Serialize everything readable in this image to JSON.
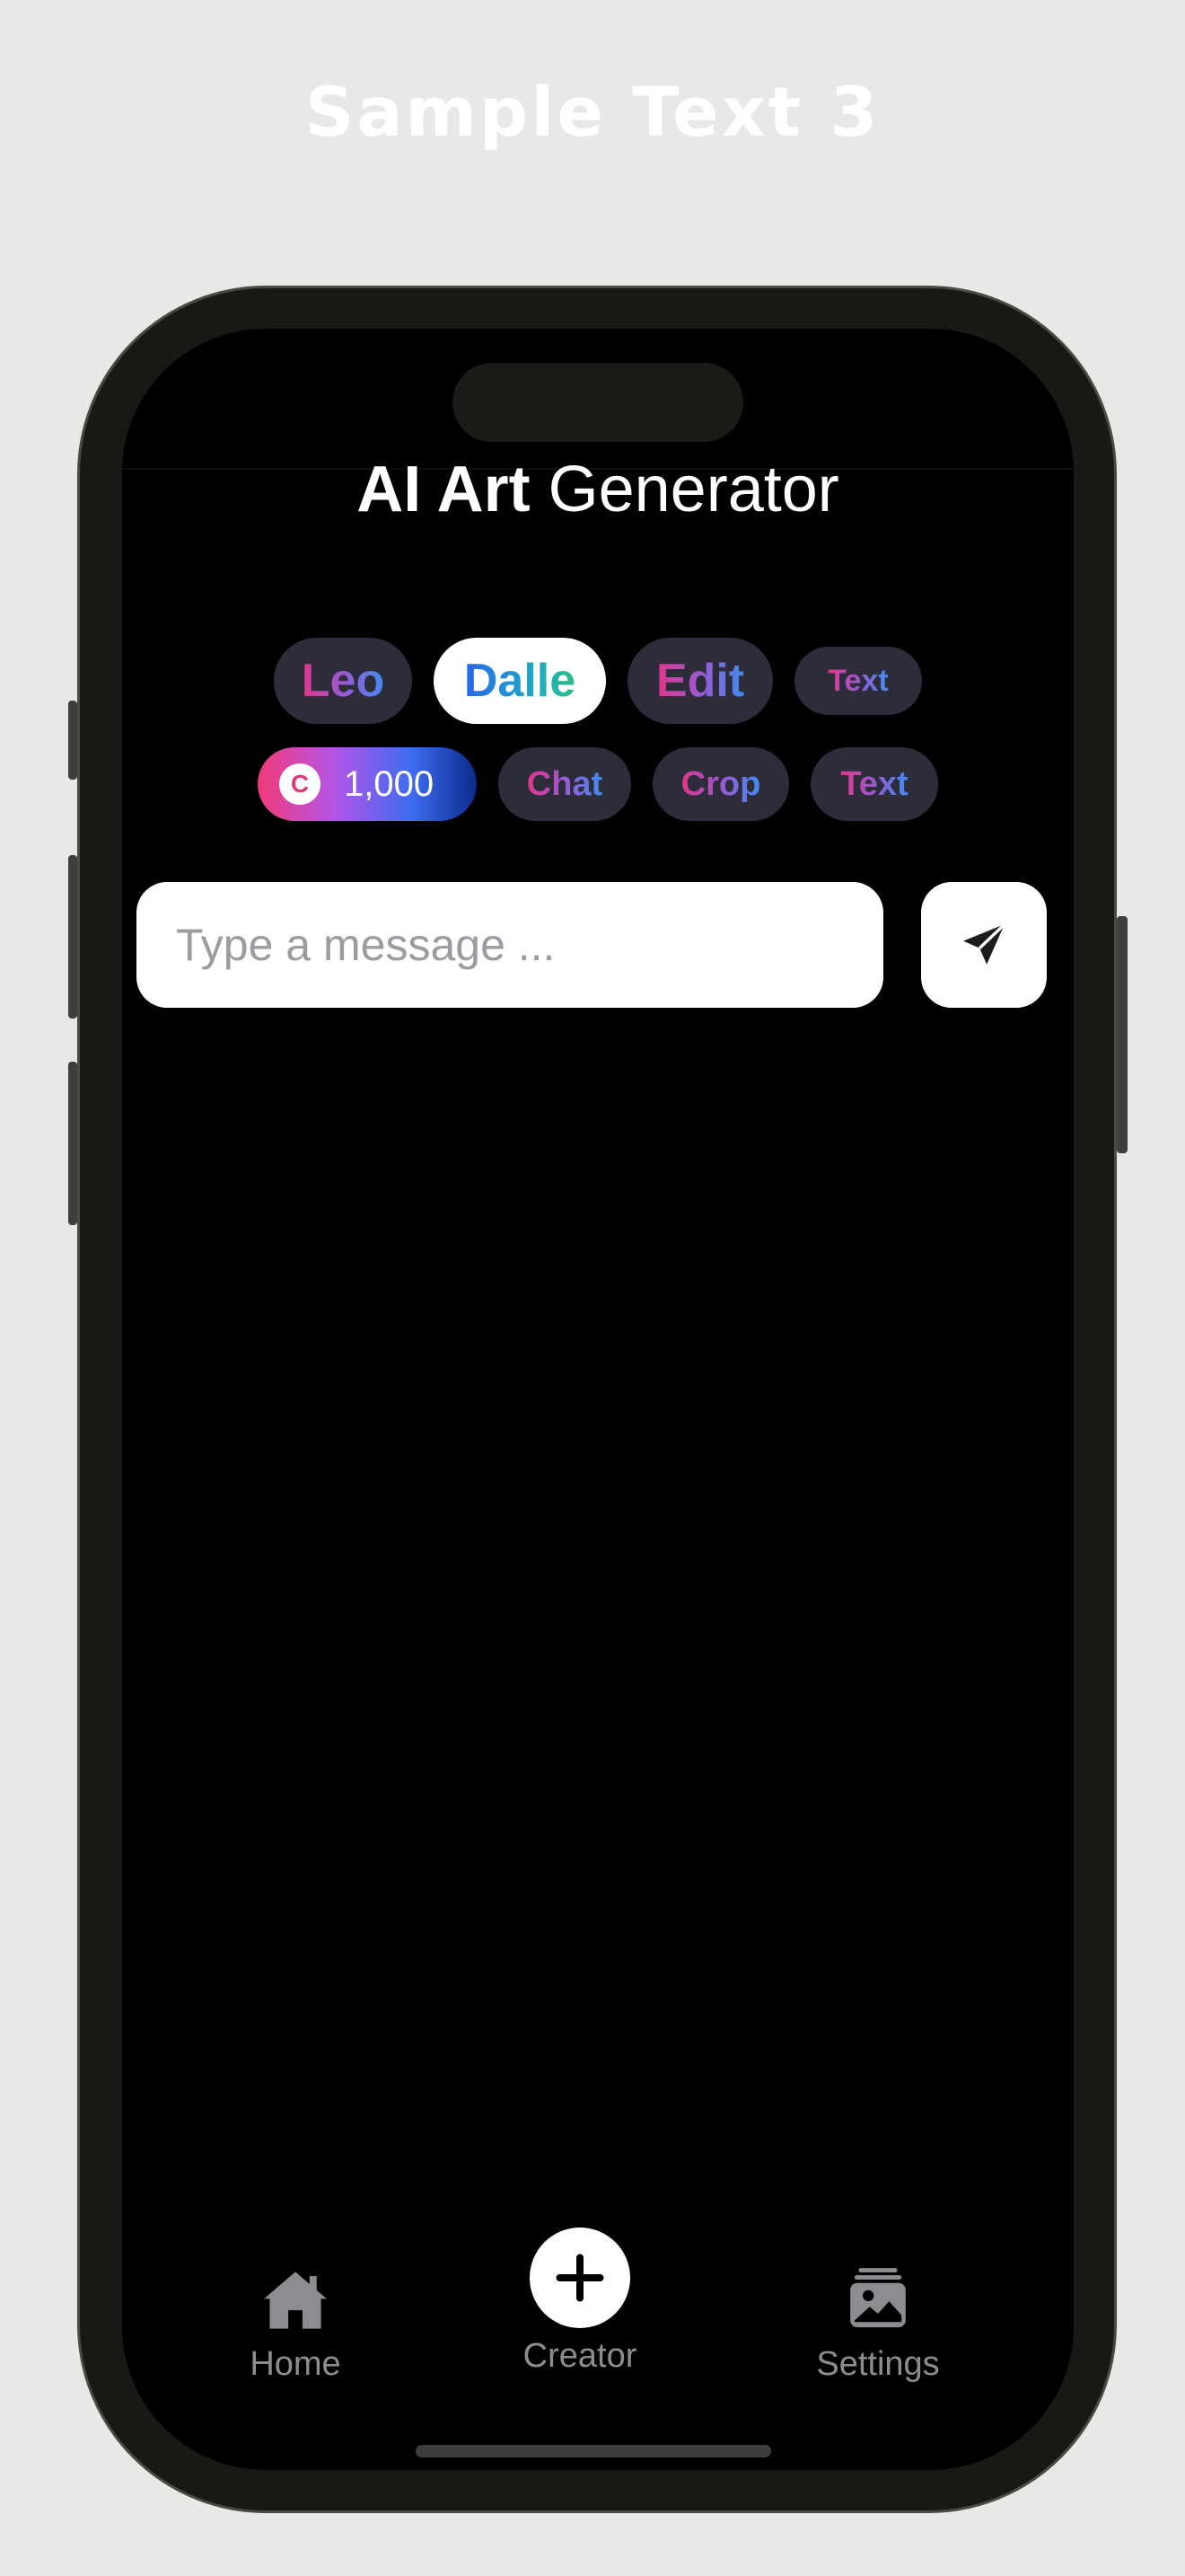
{
  "caption": "Sample Text 3",
  "app": {
    "title_bold": "AI Art",
    "title_regular": "Generator"
  },
  "model_chips_row1": [
    {
      "label": "Leo",
      "active": false
    },
    {
      "label": "Dalle",
      "active": true
    },
    {
      "label": "Edit",
      "active": false
    },
    {
      "label": "Text",
      "active": false
    }
  ],
  "credits": {
    "icon": "coin-icon",
    "icon_letter": "C",
    "value": "1,000"
  },
  "model_chips_row2": [
    {
      "label": "Chat"
    },
    {
      "label": "Crop"
    },
    {
      "label": "Text"
    }
  ],
  "composer": {
    "placeholder": "Type a message ...",
    "value": "",
    "send_icon": "send-icon"
  },
  "tabbar": {
    "items": [
      {
        "label": "Home",
        "icon": "home-icon"
      },
      {
        "label": "Creator",
        "icon": "plus-icon"
      },
      {
        "label": "Settings",
        "icon": "gallery-icon"
      }
    ]
  },
  "colors": {
    "background": "#e9e8e6",
    "phone_frame": "#181914",
    "screen": "#000000",
    "chip_bg": "#2c2c3a",
    "chip_gradient_start": "#e2358a",
    "chip_gradient_end": "#3f8cf0",
    "tab_label": "#8d8d91"
  }
}
